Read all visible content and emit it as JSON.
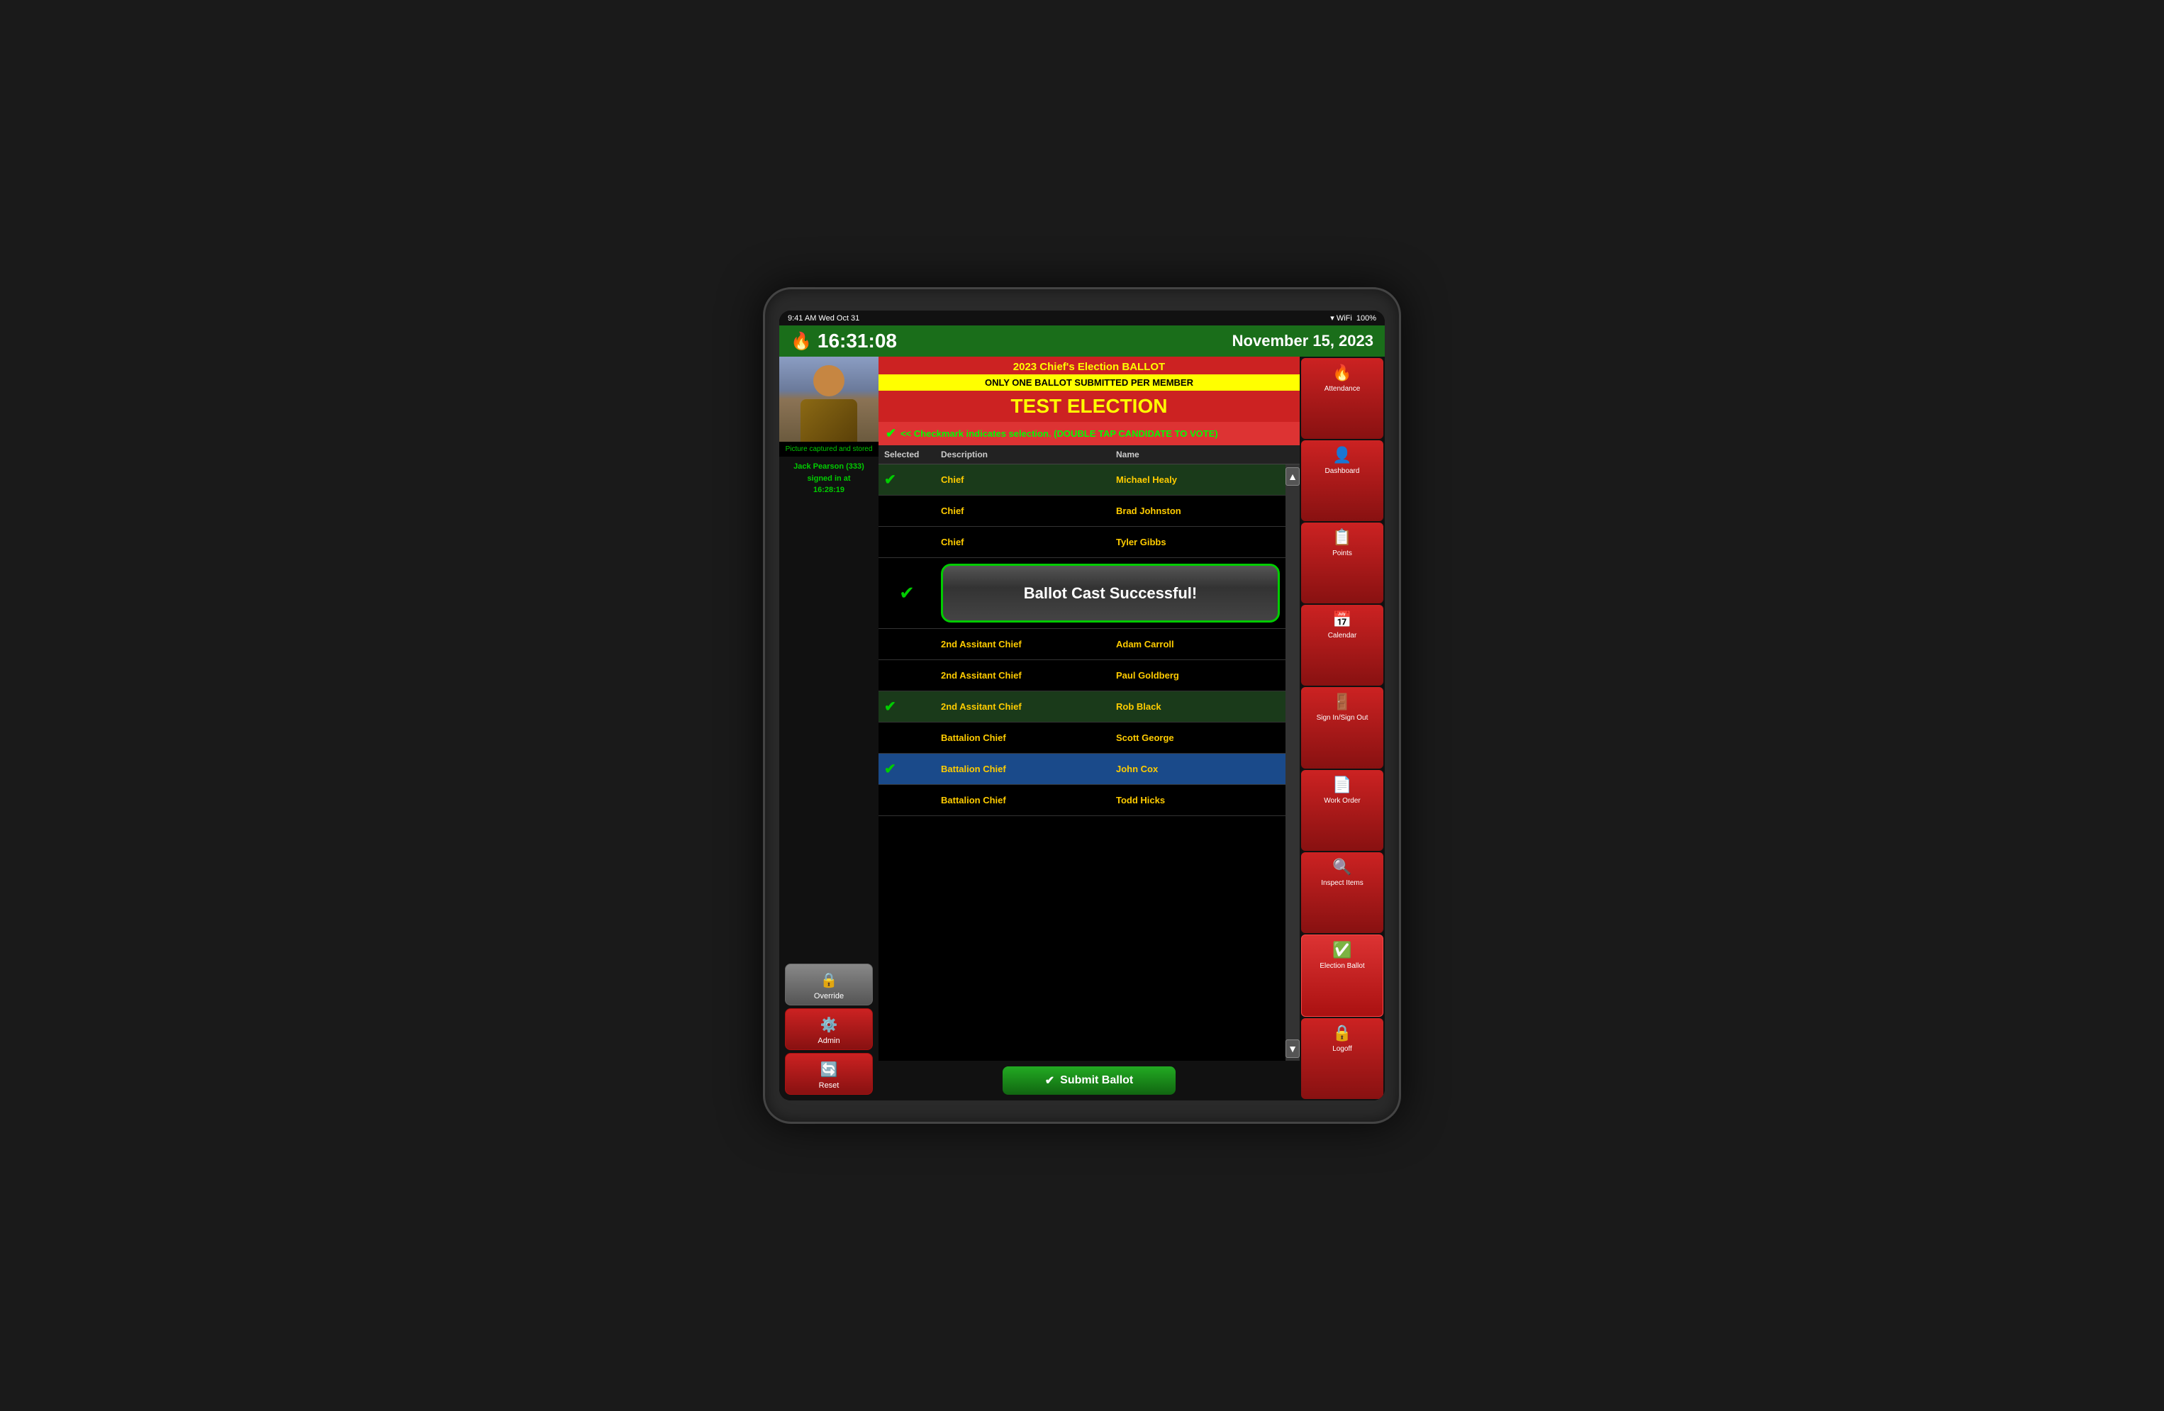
{
  "statusBar": {
    "time": "9:41 AM  Wed Oct 31",
    "battery": "100%",
    "signal": "●●●● ▾"
  },
  "header": {
    "time": "16:31:08",
    "date": "November 15, 2023"
  },
  "user": {
    "pictureCaptured": "Picture captured and stored",
    "name": "Jack Pearson (333)",
    "signedIn": "signed in at",
    "signTime": "16:28:19"
  },
  "ballot": {
    "title": "2023 Chief's Election BALLOT",
    "warning": "ONLY ONE BALLOT SUBMITTED PER MEMBER",
    "electionName": "TEST ELECTION",
    "instruction": "<< Checkmark indicates selection. (DOUBLE TAP CANDIDATE TO VOTE)"
  },
  "tableHeaders": [
    "Selected",
    "Description",
    "Name"
  ],
  "candidates": [
    {
      "selected": true,
      "description": "Chief",
      "name": "Michael Healy",
      "highlighted": false
    },
    {
      "selected": false,
      "description": "Chief",
      "name": "Brad Johnston",
      "highlighted": false
    },
    {
      "selected": false,
      "description": "Chief",
      "name": "Tyler Gibbs",
      "highlighted": false
    },
    {
      "selected": true,
      "description": "",
      "name": "",
      "highlighted": false,
      "successRow": true
    },
    {
      "selected": false,
      "description": "2nd Assitant Chief",
      "name": "Adam Carroll",
      "highlighted": false
    },
    {
      "selected": false,
      "description": "2nd Assitant Chief",
      "name": "Paul Goldberg",
      "highlighted": false
    },
    {
      "selected": true,
      "description": "2nd Assitant Chief",
      "name": "Rob Black",
      "highlighted": false
    },
    {
      "selected": false,
      "description": "Battalion Chief",
      "name": "Scott George",
      "highlighted": false
    },
    {
      "selected": true,
      "description": "Battalion Chief",
      "name": "John Cox",
      "highlighted": true
    },
    {
      "selected": false,
      "description": "Battalion Chief",
      "name": "Todd Hicks",
      "highlighted": false
    }
  ],
  "successMessage": "Ballot Cast Successful!",
  "submitButton": "Submit Ballot",
  "leftSidebar": {
    "overrideLabel": "Override",
    "adminLabel": "Admin",
    "resetLabel": "Reset"
  },
  "rightSidebar": [
    {
      "label": "Attendance",
      "icon": "🔥"
    },
    {
      "label": "Dashboard",
      "icon": "👤"
    },
    {
      "label": "Points",
      "icon": "📋"
    },
    {
      "label": "Calendar",
      "icon": "📅"
    },
    {
      "label": "Sign In/Sign Out",
      "icon": "🚪"
    },
    {
      "label": "Work Order",
      "icon": "📄"
    },
    {
      "label": "Inspect Items",
      "icon": "🔍"
    },
    {
      "label": "Election Ballot",
      "icon": "✅"
    },
    {
      "label": "Logoff",
      "icon": "🔒"
    }
  ]
}
